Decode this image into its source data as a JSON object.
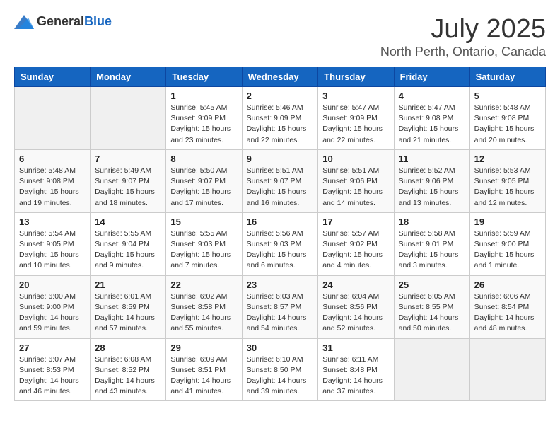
{
  "header": {
    "logo_general": "General",
    "logo_blue": "Blue",
    "month_title": "July 2025",
    "location": "North Perth, Ontario, Canada"
  },
  "weekdays": [
    "Sunday",
    "Monday",
    "Tuesday",
    "Wednesday",
    "Thursday",
    "Friday",
    "Saturday"
  ],
  "weeks": [
    [
      {
        "day": "",
        "sunrise": "",
        "sunset": "",
        "daylight": ""
      },
      {
        "day": "",
        "sunrise": "",
        "sunset": "",
        "daylight": ""
      },
      {
        "day": "1",
        "sunrise": "Sunrise: 5:45 AM",
        "sunset": "Sunset: 9:09 PM",
        "daylight": "Daylight: 15 hours and 23 minutes."
      },
      {
        "day": "2",
        "sunrise": "Sunrise: 5:46 AM",
        "sunset": "Sunset: 9:09 PM",
        "daylight": "Daylight: 15 hours and 22 minutes."
      },
      {
        "day": "3",
        "sunrise": "Sunrise: 5:47 AM",
        "sunset": "Sunset: 9:09 PM",
        "daylight": "Daylight: 15 hours and 22 minutes."
      },
      {
        "day": "4",
        "sunrise": "Sunrise: 5:47 AM",
        "sunset": "Sunset: 9:08 PM",
        "daylight": "Daylight: 15 hours and 21 minutes."
      },
      {
        "day": "5",
        "sunrise": "Sunrise: 5:48 AM",
        "sunset": "Sunset: 9:08 PM",
        "daylight": "Daylight: 15 hours and 20 minutes."
      }
    ],
    [
      {
        "day": "6",
        "sunrise": "Sunrise: 5:48 AM",
        "sunset": "Sunset: 9:08 PM",
        "daylight": "Daylight: 15 hours and 19 minutes."
      },
      {
        "day": "7",
        "sunrise": "Sunrise: 5:49 AM",
        "sunset": "Sunset: 9:07 PM",
        "daylight": "Daylight: 15 hours and 18 minutes."
      },
      {
        "day": "8",
        "sunrise": "Sunrise: 5:50 AM",
        "sunset": "Sunset: 9:07 PM",
        "daylight": "Daylight: 15 hours and 17 minutes."
      },
      {
        "day": "9",
        "sunrise": "Sunrise: 5:51 AM",
        "sunset": "Sunset: 9:07 PM",
        "daylight": "Daylight: 15 hours and 16 minutes."
      },
      {
        "day": "10",
        "sunrise": "Sunrise: 5:51 AM",
        "sunset": "Sunset: 9:06 PM",
        "daylight": "Daylight: 15 hours and 14 minutes."
      },
      {
        "day": "11",
        "sunrise": "Sunrise: 5:52 AM",
        "sunset": "Sunset: 9:06 PM",
        "daylight": "Daylight: 15 hours and 13 minutes."
      },
      {
        "day": "12",
        "sunrise": "Sunrise: 5:53 AM",
        "sunset": "Sunset: 9:05 PM",
        "daylight": "Daylight: 15 hours and 12 minutes."
      }
    ],
    [
      {
        "day": "13",
        "sunrise": "Sunrise: 5:54 AM",
        "sunset": "Sunset: 9:05 PM",
        "daylight": "Daylight: 15 hours and 10 minutes."
      },
      {
        "day": "14",
        "sunrise": "Sunrise: 5:55 AM",
        "sunset": "Sunset: 9:04 PM",
        "daylight": "Daylight: 15 hours and 9 minutes."
      },
      {
        "day": "15",
        "sunrise": "Sunrise: 5:55 AM",
        "sunset": "Sunset: 9:03 PM",
        "daylight": "Daylight: 15 hours and 7 minutes."
      },
      {
        "day": "16",
        "sunrise": "Sunrise: 5:56 AM",
        "sunset": "Sunset: 9:03 PM",
        "daylight": "Daylight: 15 hours and 6 minutes."
      },
      {
        "day": "17",
        "sunrise": "Sunrise: 5:57 AM",
        "sunset": "Sunset: 9:02 PM",
        "daylight": "Daylight: 15 hours and 4 minutes."
      },
      {
        "day": "18",
        "sunrise": "Sunrise: 5:58 AM",
        "sunset": "Sunset: 9:01 PM",
        "daylight": "Daylight: 15 hours and 3 minutes."
      },
      {
        "day": "19",
        "sunrise": "Sunrise: 5:59 AM",
        "sunset": "Sunset: 9:00 PM",
        "daylight": "Daylight: 15 hours and 1 minute."
      }
    ],
    [
      {
        "day": "20",
        "sunrise": "Sunrise: 6:00 AM",
        "sunset": "Sunset: 9:00 PM",
        "daylight": "Daylight: 14 hours and 59 minutes."
      },
      {
        "day": "21",
        "sunrise": "Sunrise: 6:01 AM",
        "sunset": "Sunset: 8:59 PM",
        "daylight": "Daylight: 14 hours and 57 minutes."
      },
      {
        "day": "22",
        "sunrise": "Sunrise: 6:02 AM",
        "sunset": "Sunset: 8:58 PM",
        "daylight": "Daylight: 14 hours and 55 minutes."
      },
      {
        "day": "23",
        "sunrise": "Sunrise: 6:03 AM",
        "sunset": "Sunset: 8:57 PM",
        "daylight": "Daylight: 14 hours and 54 minutes."
      },
      {
        "day": "24",
        "sunrise": "Sunrise: 6:04 AM",
        "sunset": "Sunset: 8:56 PM",
        "daylight": "Daylight: 14 hours and 52 minutes."
      },
      {
        "day": "25",
        "sunrise": "Sunrise: 6:05 AM",
        "sunset": "Sunset: 8:55 PM",
        "daylight": "Daylight: 14 hours and 50 minutes."
      },
      {
        "day": "26",
        "sunrise": "Sunrise: 6:06 AM",
        "sunset": "Sunset: 8:54 PM",
        "daylight": "Daylight: 14 hours and 48 minutes."
      }
    ],
    [
      {
        "day": "27",
        "sunrise": "Sunrise: 6:07 AM",
        "sunset": "Sunset: 8:53 PM",
        "daylight": "Daylight: 14 hours and 46 minutes."
      },
      {
        "day": "28",
        "sunrise": "Sunrise: 6:08 AM",
        "sunset": "Sunset: 8:52 PM",
        "daylight": "Daylight: 14 hours and 43 minutes."
      },
      {
        "day": "29",
        "sunrise": "Sunrise: 6:09 AM",
        "sunset": "Sunset: 8:51 PM",
        "daylight": "Daylight: 14 hours and 41 minutes."
      },
      {
        "day": "30",
        "sunrise": "Sunrise: 6:10 AM",
        "sunset": "Sunset: 8:50 PM",
        "daylight": "Daylight: 14 hours and 39 minutes."
      },
      {
        "day": "31",
        "sunrise": "Sunrise: 6:11 AM",
        "sunset": "Sunset: 8:48 PM",
        "daylight": "Daylight: 14 hours and 37 minutes."
      },
      {
        "day": "",
        "sunrise": "",
        "sunset": "",
        "daylight": ""
      },
      {
        "day": "",
        "sunrise": "",
        "sunset": "",
        "daylight": ""
      }
    ]
  ]
}
